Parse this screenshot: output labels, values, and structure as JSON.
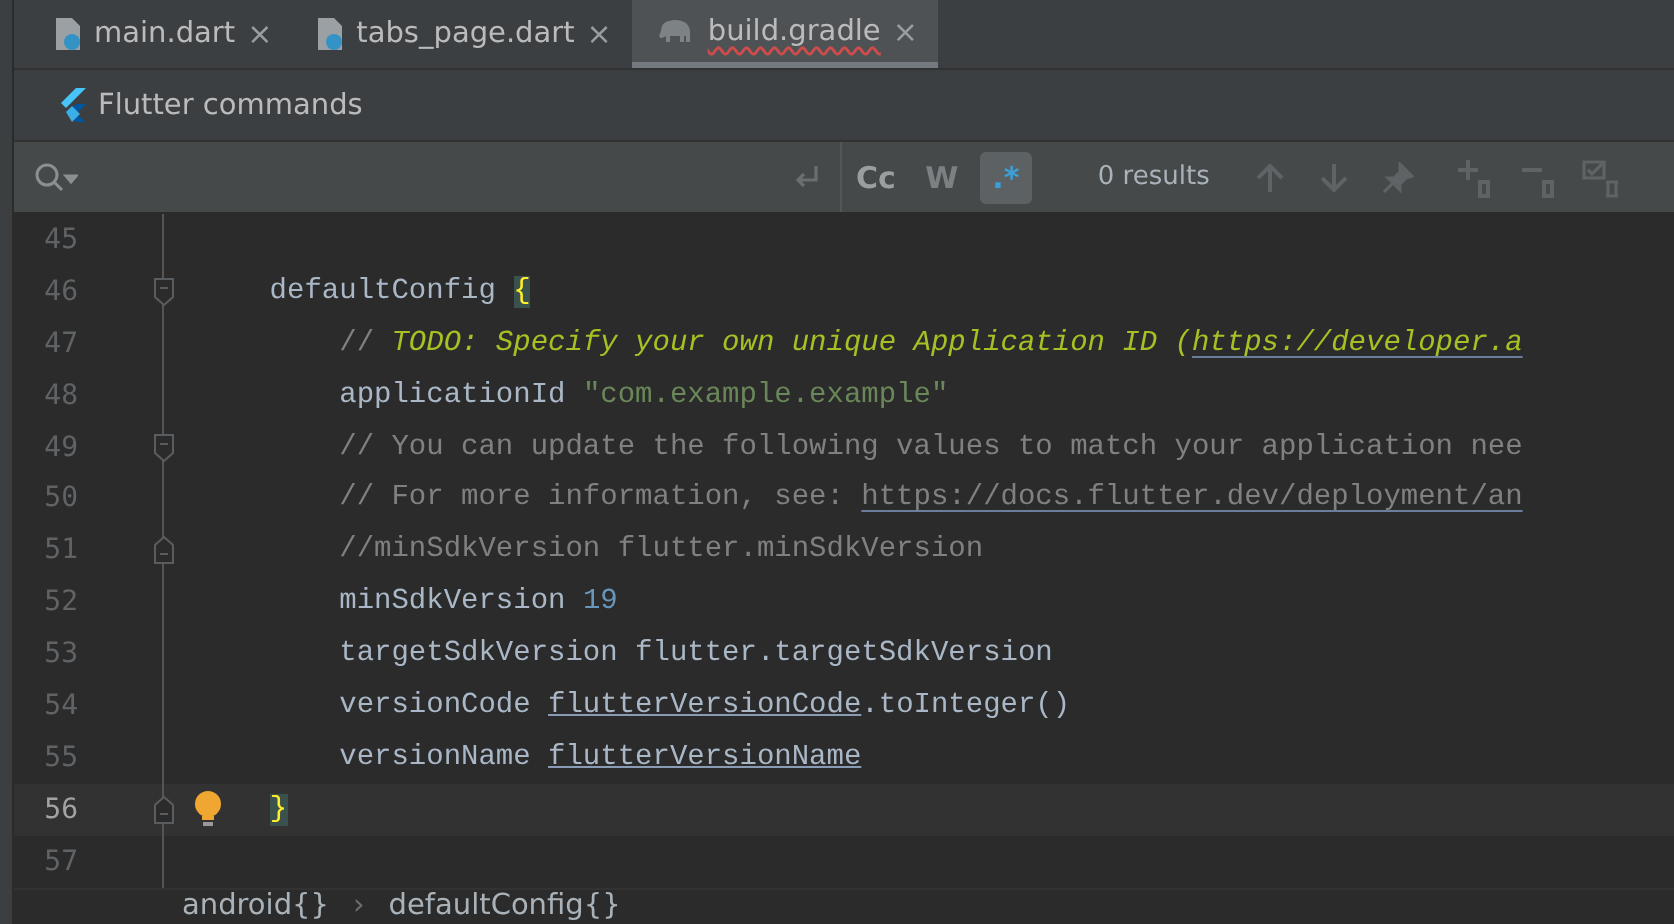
{
  "tabs": [
    {
      "label": "main.dart",
      "kind": "dart",
      "selected": false,
      "error": false,
      "close": "×"
    },
    {
      "label": "tabs_page.dart",
      "kind": "dart",
      "selected": false,
      "error": false,
      "close": "×"
    },
    {
      "label": "build.gradle",
      "kind": "gradle",
      "selected": true,
      "error": true,
      "close": "×"
    }
  ],
  "flutter_bar": {
    "label": "Flutter commands"
  },
  "search": {
    "options": [
      {
        "label": "Cc",
        "selected": false,
        "disabled": false
      },
      {
        "label": "W",
        "selected": false,
        "disabled": true
      },
      {
        "label": ".*",
        "selected": true,
        "disabled": false
      }
    ],
    "results": "0 results"
  },
  "lines": [
    {
      "number": "45",
      "current": false,
      "kind": "plain",
      "bulb": false
    },
    {
      "number": "46",
      "current": false,
      "kind": "fold-start",
      "bulb": false,
      "segments": [
        {
          "kind": "plain",
          "text": "    defaultConfig "
        },
        {
          "kind": "brace",
          "text": "{"
        }
      ]
    },
    {
      "number": "47",
      "current": false,
      "kind": "plain",
      "bulb": false,
      "segments": [
        {
          "kind": "comment",
          "text": "        // "
        },
        {
          "kind": "todo",
          "text": "TODO: Specify your own unique Application ID ("
        },
        {
          "kind": "todo-link",
          "text": "https://developer.a"
        }
      ]
    },
    {
      "number": "48",
      "current": false,
      "kind": "plain",
      "bulb": false,
      "segments": [
        {
          "kind": "plain",
          "text": "        applicationId "
        },
        {
          "kind": "string",
          "text": "\"com.example.example\""
        }
      ]
    },
    {
      "number": "49",
      "current": false,
      "kind": "fold-start",
      "bulb": false,
      "segments": [
        {
          "kind": "comment",
          "text": "        // You can update the following values to match your application nee"
        }
      ]
    },
    {
      "number": "50",
      "current": false,
      "kind": "plain",
      "bulb": false,
      "segments": [
        {
          "kind": "comment",
          "text": "        // For more information, see: "
        },
        {
          "kind": "comment-link",
          "text": "https://docs.flutter.dev/deployment/an"
        }
      ]
    },
    {
      "number": "51",
      "current": false,
      "kind": "fold-end",
      "bulb": false,
      "segments": [
        {
          "kind": "comment",
          "text": "        //minSdkVersion flutter.minSdkVersion"
        }
      ]
    },
    {
      "number": "52",
      "current": false,
      "kind": "plain",
      "bulb": false,
      "segments": [
        {
          "kind": "plain",
          "text": "        minSdkVersion "
        },
        {
          "kind": "number",
          "text": "19"
        }
      ]
    },
    {
      "number": "53",
      "current": false,
      "kind": "plain",
      "bulb": false,
      "segments": [
        {
          "kind": "plain",
          "text": "        targetSdkVersion flutter.targetSdkVersion"
        }
      ]
    },
    {
      "number": "54",
      "current": false,
      "kind": "plain",
      "bulb": false,
      "segments": [
        {
          "kind": "plain",
          "text": "        versionCode "
        },
        {
          "kind": "underlined",
          "text": "flutterVersionCode"
        },
        {
          "kind": "plain",
          "text": ".toInteger()"
        }
      ]
    },
    {
      "number": "55",
      "current": false,
      "kind": "plain",
      "bulb": false,
      "segments": [
        {
          "kind": "plain",
          "text": "        versionName "
        },
        {
          "kind": "underlined",
          "text": "flutterVersionName"
        }
      ]
    },
    {
      "number": "56",
      "current": true,
      "kind": "fold-end",
      "bulb": true,
      "segments": [
        {
          "kind": "brace",
          "text": "    }"
        }
      ]
    },
    {
      "number": "57",
      "current": false,
      "kind": "plain",
      "bulb": false
    }
  ],
  "breadcrumbs": [
    {
      "label": "android{}",
      "separator": "›"
    },
    {
      "label": "defaultConfig{}"
    }
  ]
}
